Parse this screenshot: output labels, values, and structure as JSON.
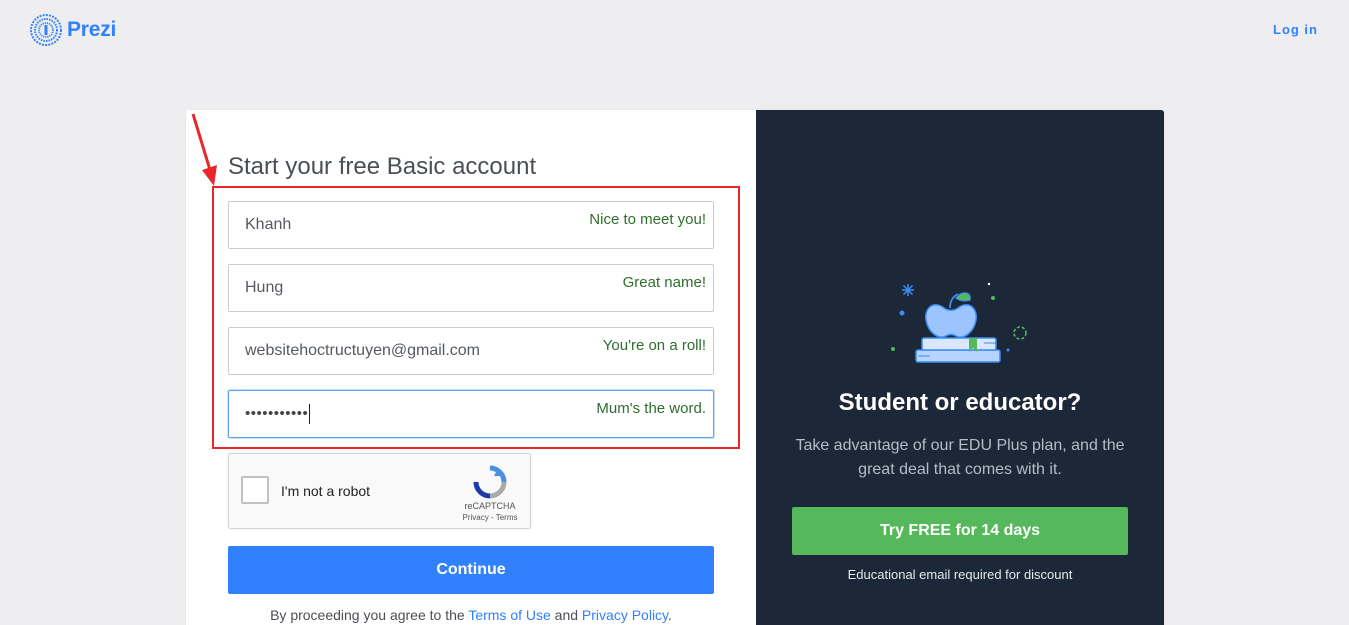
{
  "header": {
    "logo_text": "Prezi",
    "login_label": "Log in"
  },
  "form": {
    "title": "Start your free Basic account",
    "fields": [
      {
        "value": "Khanh",
        "hint": "Nice to meet you!"
      },
      {
        "value": "Hung",
        "hint": "Great name!"
      },
      {
        "value": "websitehoctructuyen@gmail.com",
        "hint": "You're on a roll!"
      },
      {
        "value_masked": "•••••••••••",
        "hint": "Mum's the word."
      }
    ],
    "recaptcha": {
      "label": "I'm not a robot",
      "brand": "reCAPTCHA",
      "links": "Privacy - Terms"
    },
    "continue_label": "Continue",
    "legal": {
      "prefix": "By proceeding you agree to the",
      "terms_label": "Terms of Use",
      "and": "and",
      "privacy_label": "Privacy Policy",
      "suffix": "."
    }
  },
  "edu": {
    "title": "Student or educator?",
    "description": "Take advantage of our EDU Plus plan, and the great deal that comes with it.",
    "cta_label": "Try FREE for 14 days",
    "note": "Educational email required for discount"
  },
  "icons": {
    "logo": "prezi-logo-icon",
    "recaptcha": "recaptcha-icon",
    "edu": "apple-on-books-icon",
    "annotation": "red-arrow-icon"
  },
  "colors": {
    "brand": "#3181ff",
    "edu_panel": "#1c2737",
    "edu_button": "#55b85a",
    "hint_text": "#2e6e2e",
    "annotation": "#e8262b"
  }
}
